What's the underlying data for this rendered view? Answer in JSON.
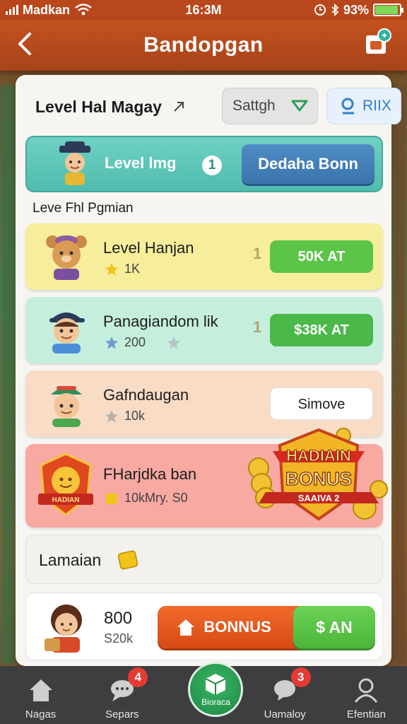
{
  "status_bar": {
    "carrier": "Madkan",
    "time": "16:3M",
    "battery": "93%",
    "battery_level": 0.93
  },
  "header": {
    "title": "Bandopgan"
  },
  "top_row": {
    "title": "Level Hal Magay",
    "select_value": "Sattgh",
    "search_label": "RIIX"
  },
  "level_banner": {
    "label": "Level lmg",
    "number": "1",
    "button": "Dedaha Bonn"
  },
  "section_label": "Leve Fhl Pgmian",
  "cards": [
    {
      "name": "Level Hanjan",
      "sub": "1K",
      "count": "1",
      "action": "50K AT",
      "bg": "#f6ee9a",
      "btn": "#5cc547"
    },
    {
      "name": "Panagiandom lik",
      "sub": "200",
      "count": "1",
      "action": "$38K AT",
      "bg": "#c6eedd",
      "btn": "#4bb84a"
    },
    {
      "name": "Gafndaugan",
      "sub": "10k",
      "count": "",
      "action": "Simove",
      "bg": "#f8dcc6",
      "btn": "#ffffff"
    },
    {
      "name": "FHarjdka ban",
      "sub": "10kMry. S0",
      "count": "",
      "action": "",
      "bg": "#f7a9a2",
      "btn": ""
    }
  ],
  "bonus_badge": {
    "line1": "HADIAIN",
    "line2": "BONUS",
    "line3": "SAAIVA 2"
  },
  "badge_small_text": "HADIAN",
  "footer": {
    "label": "Lamaian",
    "amount": "800",
    "amount_sub": "S20k",
    "bonus_button": "BONNUS",
    "san_button": "$ AN"
  },
  "nav": [
    {
      "label": "Nagas",
      "badge": ""
    },
    {
      "label": "Separs",
      "badge": "4"
    },
    {
      "label": "Bioraca",
      "badge": ""
    },
    {
      "label": "Uamaloy",
      "badge": "3"
    },
    {
      "label": "Efentian",
      "badge": ""
    }
  ],
  "colors": {
    "header": "#c4521f",
    "accent_teal": "#4fbcae",
    "accent_blue": "#3b74ad",
    "nav_bg": "#3e3e40",
    "bonus_orange": "#e0561c",
    "bonus_green": "#55bf41"
  }
}
